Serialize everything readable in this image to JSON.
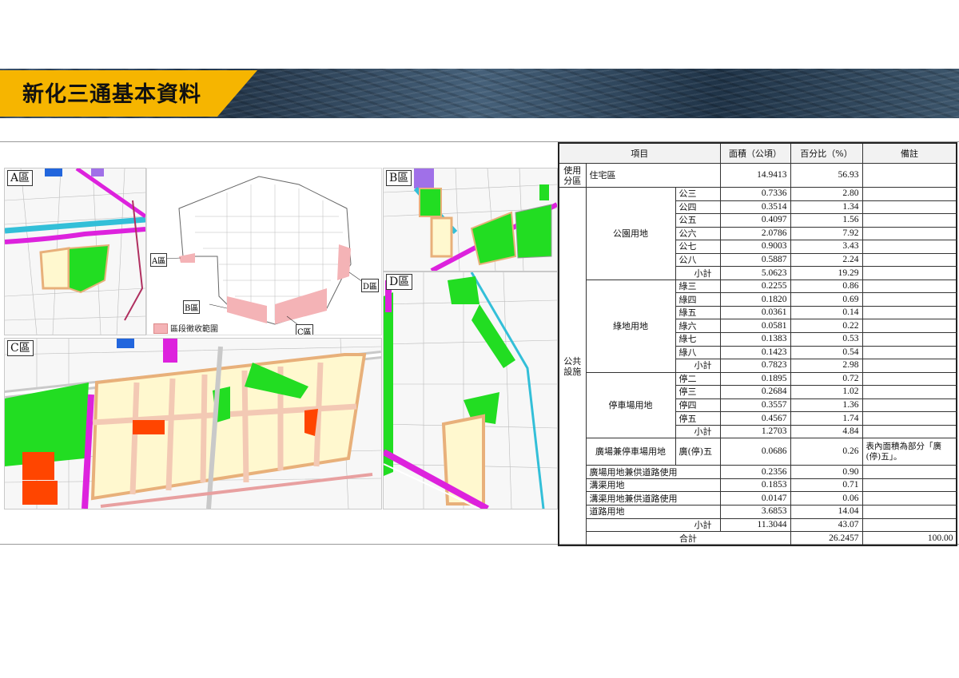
{
  "header": {
    "title": "新化三通基本資料"
  },
  "maps": {
    "panel_a_label": "A區",
    "panel_b_label": "B區",
    "panel_c_label": "C區",
    "panel_d_label": "D區",
    "overview": {
      "label_a": "A區",
      "label_b": "B區",
      "label_c": "C區",
      "label_d": "D區",
      "legend_text": "區段徵收範圍"
    },
    "colors": {
      "residential": "#fff8cf",
      "park": "#22dd22",
      "road": "#f3c9b4",
      "parking": "#ff4500",
      "magenta": "#dd22dd",
      "purple": "#a070e8",
      "water": "#33bfd8",
      "blue": "#2266dd",
      "expropriation": "#f4b3b6"
    }
  },
  "table": {
    "headers": {
      "item": "項目",
      "area": "面積（公頃）",
      "percent": "百分比（%）",
      "note": "備註"
    },
    "use_zone": {
      "category": "使用分區",
      "name": "住宅區",
      "area": "14.9413",
      "percent": "56.93"
    },
    "public_category": "公共設施",
    "parks": {
      "name": "公園用地",
      "rows": [
        {
          "sub": "公三",
          "area": "0.7336",
          "percent": "2.80"
        },
        {
          "sub": "公四",
          "area": "0.3514",
          "percent": "1.34"
        },
        {
          "sub": "公五",
          "area": "0.4097",
          "percent": "1.56"
        },
        {
          "sub": "公六",
          "area": "2.0786",
          "percent": "7.92"
        },
        {
          "sub": "公七",
          "area": "0.9003",
          "percent": "3.43"
        },
        {
          "sub": "公八",
          "area": "0.5887",
          "percent": "2.24"
        }
      ],
      "subtotal_label": "小計",
      "subtotal_area": "5.0623",
      "subtotal_percent": "19.29"
    },
    "green": {
      "name": "綠地用地",
      "rows": [
        {
          "sub": "綠三",
          "area": "0.2255",
          "percent": "0.86"
        },
        {
          "sub": "綠四",
          "area": "0.1820",
          "percent": "0.69"
        },
        {
          "sub": "綠五",
          "area": "0.0361",
          "percent": "0.14"
        },
        {
          "sub": "綠六",
          "area": "0.0581",
          "percent": "0.22"
        },
        {
          "sub": "綠七",
          "area": "0.1383",
          "percent": "0.53"
        },
        {
          "sub": "綠八",
          "area": "0.1423",
          "percent": "0.54"
        }
      ],
      "subtotal_label": "小計",
      "subtotal_area": "0.7823",
      "subtotal_percent": "2.98"
    },
    "parking": {
      "name": "停車場用地",
      "rows": [
        {
          "sub": "停二",
          "area": "0.1895",
          "percent": "0.72"
        },
        {
          "sub": "停三",
          "area": "0.2684",
          "percent": "1.02"
        },
        {
          "sub": "停四",
          "area": "0.3557",
          "percent": "1.36"
        },
        {
          "sub": "停五",
          "area": "0.4567",
          "percent": "1.74"
        }
      ],
      "subtotal_label": "小計",
      "subtotal_area": "1.2703",
      "subtotal_percent": "4.84"
    },
    "plaza_parking": {
      "name": "廣場兼停車場用地",
      "sub": "廣(停)五",
      "area": "0.0686",
      "percent": "0.26",
      "note": "表內面積為部分「廣(停)五」。"
    },
    "others": [
      {
        "name": "廣場用地兼供道路使用",
        "area": "0.2356",
        "percent": "0.90"
      },
      {
        "name": "溝渠用地",
        "area": "0.1853",
        "percent": "0.71"
      },
      {
        "name": "溝渠用地兼供道路使用",
        "area": "0.0147",
        "percent": "0.06"
      },
      {
        "name": "道路用地",
        "area": "3.6853",
        "percent": "14.04"
      }
    ],
    "public_subtotal": {
      "label": "小計",
      "area": "11.3044",
      "percent": "43.07"
    },
    "total": {
      "label": "合計",
      "area": "26.2457",
      "percent": "100.00"
    }
  }
}
